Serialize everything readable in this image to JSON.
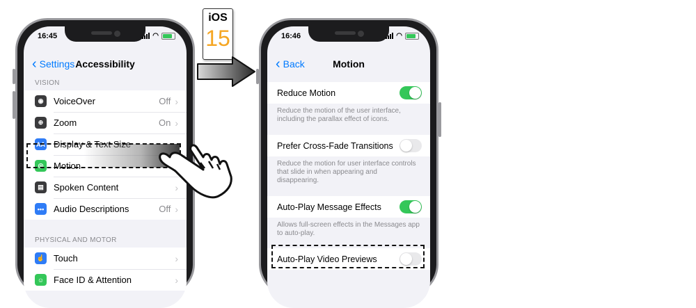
{
  "badge": {
    "line1": "iOS",
    "line2": "15"
  },
  "left_phone": {
    "time": "16:45",
    "back_label": "Settings",
    "title": "Accessibility",
    "section_vision": "VISION",
    "vision_items": [
      {
        "label": "VoiceOver",
        "value": "Off",
        "icon": "voiceover-icon",
        "color": "#3a3a3c",
        "glyph": "◉"
      },
      {
        "label": "Zoom",
        "value": "On",
        "icon": "zoom-icon",
        "color": "#3a3a3c",
        "glyph": "⊕"
      },
      {
        "label": "Display & Text Size",
        "value": "",
        "icon": "display-text-size-icon",
        "color": "#2f7cf6",
        "glyph": "AA"
      },
      {
        "label": "Motion",
        "value": "",
        "icon": "motion-icon",
        "color": "#34c759",
        "glyph": "◎"
      },
      {
        "label": "Spoken Content",
        "value": "",
        "icon": "spoken-content-icon",
        "color": "#3a3a3c",
        "glyph": "▤"
      },
      {
        "label": "Audio Descriptions",
        "value": "Off",
        "icon": "audio-descriptions-icon",
        "color": "#2f7cf6",
        "glyph": "•••"
      }
    ],
    "section_physical": "PHYSICAL AND MOTOR",
    "physical_items": [
      {
        "label": "Touch",
        "value": "",
        "icon": "touch-icon",
        "color": "#2f7cf6",
        "glyph": "☝"
      },
      {
        "label": "Face ID & Attention",
        "value": "",
        "icon": "face-id-icon",
        "color": "#34c759",
        "glyph": "☺"
      }
    ]
  },
  "right_phone": {
    "time": "16:46",
    "back_label": "Back",
    "title": "Motion",
    "settings": [
      {
        "label": "Reduce Motion",
        "on": true,
        "desc": "Reduce the motion of the user interface, including the parallax effect of icons."
      },
      {
        "label": "Prefer Cross-Fade Transitions",
        "on": false,
        "desc": "Reduce the motion for user interface controls that slide in when appearing and disappearing."
      },
      {
        "label": "Auto-Play Message Effects",
        "on": true,
        "desc": "Allows full-screen effects in the Messages app to auto-play."
      },
      {
        "label": "Auto-Play Video Previews",
        "on": false,
        "desc": ""
      }
    ]
  },
  "colors": {
    "accent": "#007aff",
    "toggle_on": "#34c759",
    "badge_number": "#f5a623"
  }
}
